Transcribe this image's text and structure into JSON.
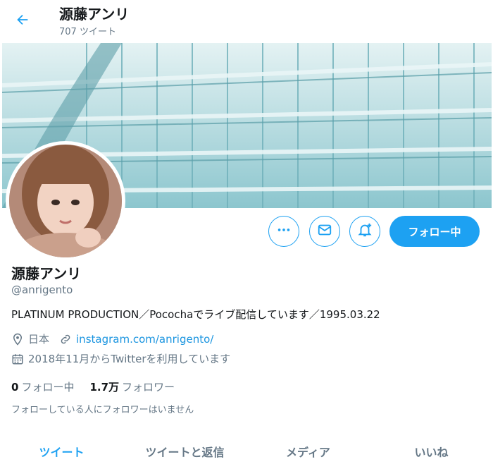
{
  "header": {
    "title": "源藤アンリ",
    "tweet_count": "707 ツイート"
  },
  "profile": {
    "name": "源藤アンリ",
    "handle": "@anrigento",
    "bio": "PLATINUM PRODUCTION／Pocochaでライブ配信しています／1995.03.22",
    "location": "日本",
    "website": "instagram.com/anrigento/",
    "joined": "2018年11月からTwitterを利用しています"
  },
  "actions": {
    "follow_label": "フォロー中"
  },
  "stats": {
    "following_count": "0",
    "following_label": "フォロー中",
    "followers_count": "1.7万",
    "followers_label": "フォロワー"
  },
  "followers_note": "フォローしている人にフォロワーはいません",
  "tabs": [
    {
      "label": "ツイート",
      "active": true
    },
    {
      "label": "ツイートと返信",
      "active": false
    },
    {
      "label": "メディア",
      "active": false
    },
    {
      "label": "いいね",
      "active": false
    }
  ],
  "colors": {
    "accent": "#1da1f2",
    "link": "#1b95e0",
    "secondary_text": "#657786"
  },
  "icons": [
    "back-arrow-icon",
    "more-icon",
    "message-icon",
    "bell-plus-icon",
    "location-icon",
    "link-icon",
    "calendar-icon"
  ]
}
